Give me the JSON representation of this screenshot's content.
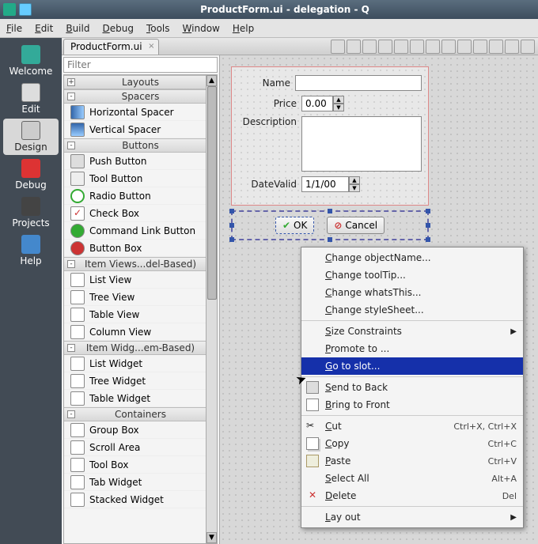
{
  "window": {
    "title": "ProductForm.ui - delegation - Q"
  },
  "menubar": [
    "File",
    "Edit",
    "Build",
    "Debug",
    "Tools",
    "Window",
    "Help"
  ],
  "sidenav": [
    {
      "label": "Welcome",
      "icn": "icn-welcome",
      "active": false
    },
    {
      "label": "Edit",
      "icn": "icn-edit",
      "active": false
    },
    {
      "label": "Design",
      "icn": "icn-design",
      "active": true
    },
    {
      "label": "Debug",
      "icn": "icn-debug",
      "active": false
    },
    {
      "label": "Projects",
      "icn": "icn-projects",
      "active": false
    },
    {
      "label": "Help",
      "icn": "icn-help",
      "active": false
    }
  ],
  "tab": {
    "label": "ProductForm.ui"
  },
  "filter_placeholder": "Filter",
  "widgetbox": {
    "cats": [
      {
        "name": "Layouts",
        "pm": "+",
        "items": []
      },
      {
        "name": "Spacers",
        "pm": "-",
        "items": [
          {
            "label": "Horizontal Spacer",
            "cls": "hs"
          },
          {
            "label": "Vertical Spacer",
            "cls": "vs"
          }
        ]
      },
      {
        "name": "Buttons",
        "pm": "-",
        "items": [
          {
            "label": "Push Button",
            "cls": "pb"
          },
          {
            "label": "Tool Button",
            "cls": "tb"
          },
          {
            "label": "Radio Button",
            "cls": "rb"
          },
          {
            "label": "Check Box",
            "cls": "cb"
          },
          {
            "label": "Command Link Button",
            "cls": "cl"
          },
          {
            "label": "Button Box",
            "cls": "bb"
          }
        ]
      },
      {
        "name": "Item Views...del-Based)",
        "pm": "-",
        "items": [
          {
            "label": "List View",
            "cls": "gen"
          },
          {
            "label": "Tree View",
            "cls": "gen"
          },
          {
            "label": "Table View",
            "cls": "gen"
          },
          {
            "label": "Column View",
            "cls": "gen"
          }
        ]
      },
      {
        "name": "Item Widg...em-Based)",
        "pm": "-",
        "items": [
          {
            "label": "List Widget",
            "cls": "gen"
          },
          {
            "label": "Tree Widget",
            "cls": "gen"
          },
          {
            "label": "Table Widget",
            "cls": "gen"
          }
        ]
      },
      {
        "name": "Containers",
        "pm": "-",
        "items": [
          {
            "label": "Group Box",
            "cls": "gen"
          },
          {
            "label": "Scroll Area",
            "cls": "gen"
          },
          {
            "label": "Tool Box",
            "cls": "gen"
          },
          {
            "label": "Tab Widget",
            "cls": "gen"
          },
          {
            "label": "Stacked Widget",
            "cls": "gen"
          }
        ]
      }
    ]
  },
  "form": {
    "fields": {
      "name": {
        "label": "Name",
        "value": ""
      },
      "price": {
        "label": "Price",
        "value": "0.00"
      },
      "desc": {
        "label": "Description",
        "value": ""
      },
      "date": {
        "label": "DateValid",
        "value": "1/1/00"
      }
    },
    "buttons": {
      "ok": "OK",
      "cancel": "Cancel"
    }
  },
  "context_menu": [
    {
      "type": "item",
      "label": "Change objectName..."
    },
    {
      "type": "item",
      "label": "Change toolTip..."
    },
    {
      "type": "item",
      "label": "Change whatsThis..."
    },
    {
      "type": "item",
      "label": "Change styleSheet..."
    },
    {
      "type": "sep"
    },
    {
      "type": "item",
      "label": "Size Constraints",
      "sub": true
    },
    {
      "type": "item",
      "label": "Promote to ..."
    },
    {
      "type": "item",
      "label": "Go to slot...",
      "selected": true
    },
    {
      "type": "sep"
    },
    {
      "type": "item",
      "label": "Send to Back",
      "icon": "back"
    },
    {
      "type": "item",
      "label": "Bring to Front",
      "icon": "front"
    },
    {
      "type": "sep"
    },
    {
      "type": "item",
      "label": "Cut",
      "shortcut": "Ctrl+X, Ctrl+X",
      "icon": "cut"
    },
    {
      "type": "item",
      "label": "Copy",
      "shortcut": "Ctrl+C",
      "icon": "copy"
    },
    {
      "type": "item",
      "label": "Paste",
      "shortcut": "Ctrl+V",
      "icon": "paste"
    },
    {
      "type": "item",
      "label": "Select All",
      "shortcut": "Alt+A"
    },
    {
      "type": "item",
      "label": "Delete",
      "shortcut": "Del",
      "icon": "del"
    },
    {
      "type": "sep"
    },
    {
      "type": "item",
      "label": "Lay out",
      "sub": true
    }
  ]
}
